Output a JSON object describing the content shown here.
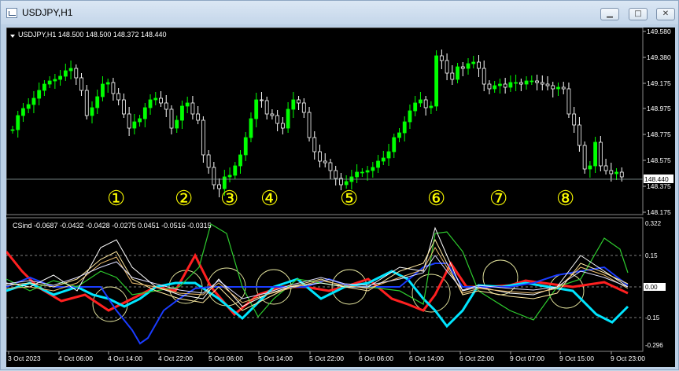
{
  "window": {
    "title": "USDJPY,H1"
  },
  "buttons": {
    "minimize": "▁",
    "maximize": "□",
    "close": "✕"
  },
  "main_panel": {
    "ohlc_label": "USDJPY,H1  148.500 148.500 148.372 148.440",
    "price_axis": [
      "149.580",
      "149.380",
      "149.175",
      "148.975",
      "148.775",
      "148.575",
      "148.375",
      "148.175"
    ],
    "current_price": "148.440",
    "markers": [
      "①",
      "②",
      "③",
      "④",
      "⑤",
      "⑥",
      "⑦",
      "⑧"
    ]
  },
  "indicator_panel": {
    "label": "CSind -0.0687 -0.0432 -0.0428 -0.0275 0.0451 -0.0516 -0.0315",
    "axis": [
      "0.322",
      "0.15",
      "0.00",
      "-0.15",
      "-0.296"
    ],
    "current_value": "0.00"
  },
  "time_axis": [
    "3 Oct 2023",
    "4 Oct 06:00",
    "4 Oct 14:00",
    "4 Oct 22:00",
    "5 Oct 06:00",
    "5 Oct 14:00",
    "5 Oct 22:00",
    "6 Oct 06:00",
    "6 Oct 14:00",
    "6 Oct 22:00",
    "9 Oct 07:00",
    "9 Oct 15:00",
    "9 Oct 23:00"
  ],
  "colors": {
    "bull": "#00ff00",
    "bear": "#ffffff",
    "marker": "#ffff00",
    "bg": "#000000"
  }
}
